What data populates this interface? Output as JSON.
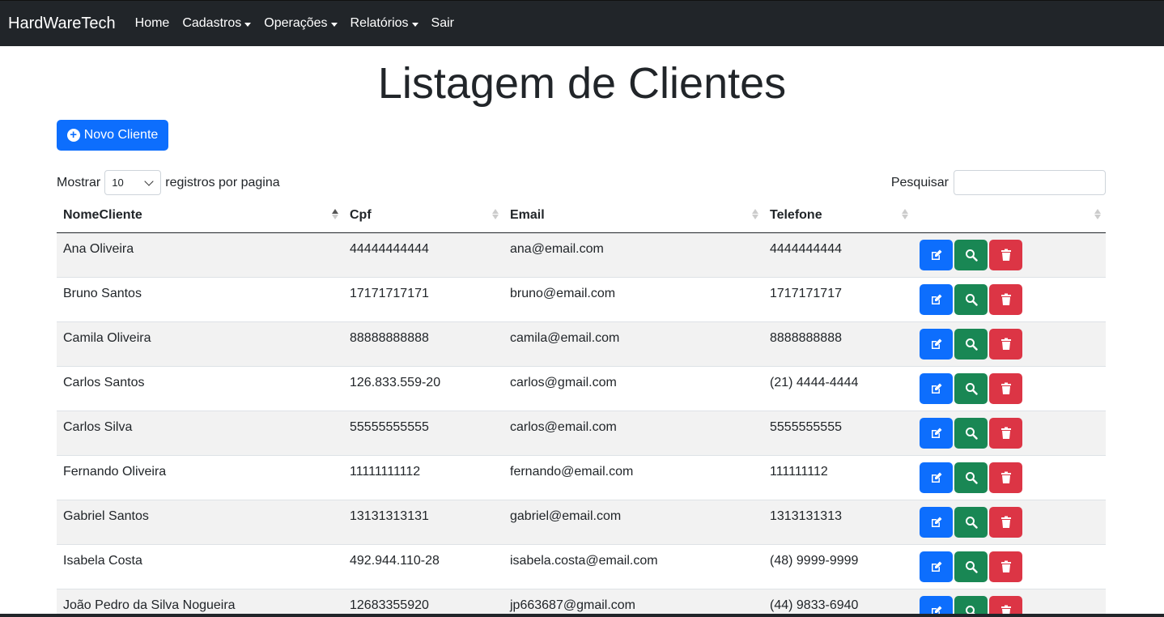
{
  "navbar": {
    "brand": "HardWareTech",
    "items": [
      {
        "label": "Home",
        "dropdown": false
      },
      {
        "label": "Cadastros",
        "dropdown": true
      },
      {
        "label": "Operações",
        "dropdown": true
      },
      {
        "label": "Relatórios",
        "dropdown": true
      },
      {
        "label": "Sair",
        "dropdown": false
      }
    ]
  },
  "page": {
    "title": "Listagem de Clientes",
    "new_button": "Novo Cliente"
  },
  "length_control": {
    "prefix": "Mostrar",
    "value": "10",
    "suffix": "registros por pagina"
  },
  "search": {
    "label": "Pesquisar",
    "value": ""
  },
  "table": {
    "columns": [
      "NomeCliente",
      "Cpf",
      "Email",
      "Telefone",
      ""
    ],
    "sorted_column": "NomeCliente",
    "sort_direction": "asc",
    "rows": [
      {
        "nome": "Ana Oliveira",
        "cpf": "44444444444",
        "email": "ana@email.com",
        "telefone": "4444444444"
      },
      {
        "nome": "Bruno Santos",
        "cpf": "17171717171",
        "email": "bruno@email.com",
        "telefone": "1717171717"
      },
      {
        "nome": "Camila Oliveira",
        "cpf": "88888888888",
        "email": "camila@email.com",
        "telefone": "8888888888"
      },
      {
        "nome": "Carlos Santos",
        "cpf": "126.833.559-20",
        "email": "carlos@gmail.com",
        "telefone": "(21) 4444-4444"
      },
      {
        "nome": "Carlos Silva",
        "cpf": "55555555555",
        "email": "carlos@email.com",
        "telefone": "5555555555"
      },
      {
        "nome": "Fernando Oliveira",
        "cpf": "11111111112",
        "email": "fernando@email.com",
        "telefone": "111111112"
      },
      {
        "nome": "Gabriel Santos",
        "cpf": "13131313131",
        "email": "gabriel@email.com",
        "telefone": "1313131313"
      },
      {
        "nome": "Isabela Costa",
        "cpf": "492.944.110-28",
        "email": "isabela.costa@email.com",
        "telefone": "(48) 9999-9999"
      },
      {
        "nome": "João Pedro da Silva Nogueira",
        "cpf": "12683355920",
        "email": "jp663687@gmail.com",
        "telefone": "(44) 9833-6940"
      }
    ]
  },
  "colors": {
    "navbar": "#212529",
    "primary": "#0d6efd",
    "success": "#198754",
    "danger": "#dc3545",
    "stripe": "#f2f2f2"
  },
  "icons": {
    "new": "plus-circle-icon",
    "edit": "edit-icon",
    "view": "search-icon",
    "delete": "trash-icon"
  }
}
